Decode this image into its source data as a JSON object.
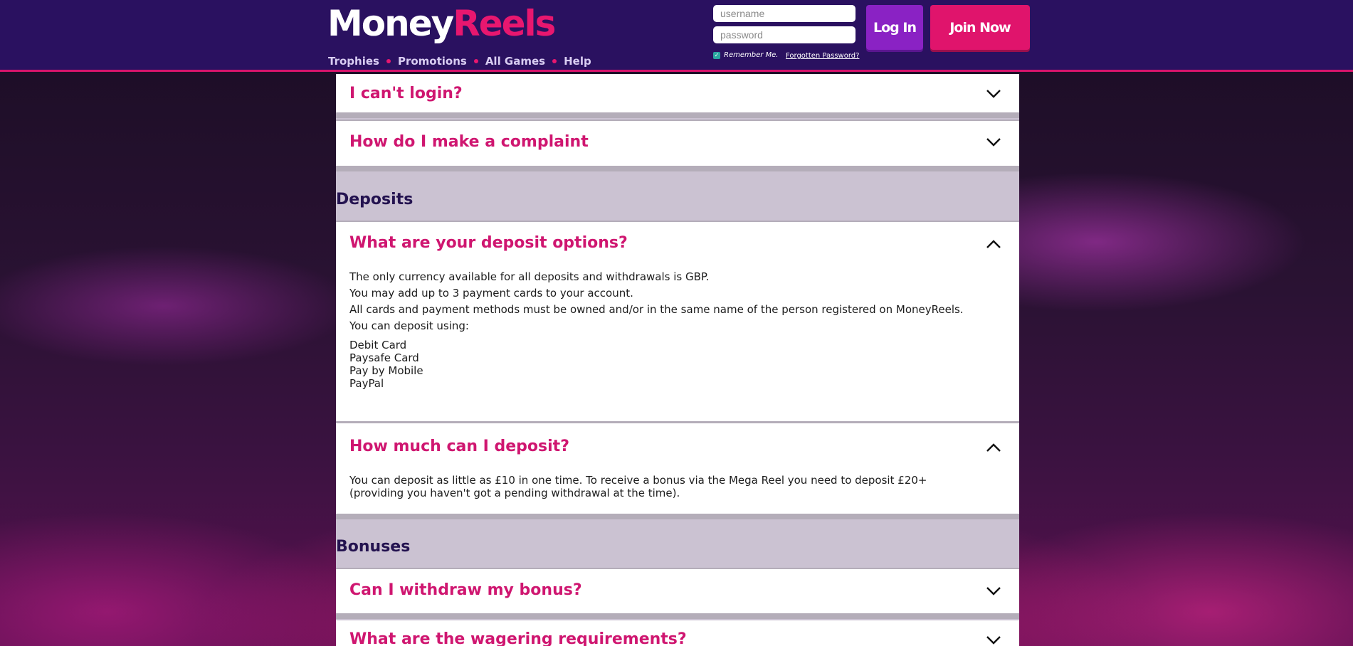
{
  "header": {
    "logo_part1": "Money",
    "logo_part2": "Reels",
    "nav": [
      "Trophies",
      "Promotions",
      "All Games",
      "Help"
    ],
    "username_placeholder": "username",
    "password_placeholder": "password",
    "remember_label": "Remember Me.",
    "forgot_label": "Forgotten Password?",
    "login_label": "Log In",
    "join_label": "Join Now"
  },
  "faq": {
    "q_cant_login": "I can't login?",
    "q_complaint": "How do I make a complaint",
    "section_deposits": "Deposits",
    "q_deposit_options": "What are your deposit options?",
    "deposit_options_lines": [
      "The only currency available for all deposits and withdrawals is GBP.",
      "You may add up to 3 payment cards to your account.",
      "All cards and payment methods must be owned and/or in the same name of the person registered on MoneyReels.",
      "You can deposit using:"
    ],
    "deposit_methods": [
      "Debit Card",
      "Paysafe Card",
      "Pay by Mobile",
      "PayPal"
    ],
    "q_how_much": "How much can I deposit?",
    "how_much_answer": "You can deposit as little as £10 in one time. To receive a bonus via the Mega Reel you need to deposit £20+ (providing you haven't got a pending withdrawal at the time).",
    "section_bonuses": "Bonuses",
    "q_withdraw_bonus": "Can I withdraw my bonus?",
    "q_wagering": "What are the wagering requirements?"
  },
  "colors": {
    "header_bg": "#2a1160",
    "accent_pink": "#e0146c",
    "login_purple": "#8a22c4",
    "question_text": "#cf1670",
    "section_text": "#241350"
  },
  "icons": {
    "collapsed": "chevron-down-icon",
    "expanded": "chevron-up-icon",
    "remember_checkbox": "check-icon"
  }
}
